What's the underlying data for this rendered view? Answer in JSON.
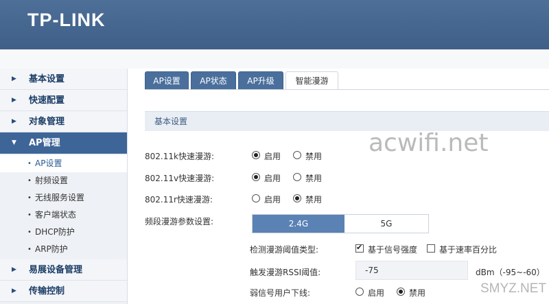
{
  "brand": {
    "logo": "TP-LINK"
  },
  "sidebar": {
    "items": [
      {
        "label": "基本设置"
      },
      {
        "label": "快速配置"
      },
      {
        "label": "对象管理"
      },
      {
        "label": "AP管理"
      },
      {
        "label": "易展设备管理"
      },
      {
        "label": "传输控制"
      }
    ],
    "sub_items": [
      {
        "label": "AP设置"
      },
      {
        "label": "射频设置"
      },
      {
        "label": "无线服务设置"
      },
      {
        "label": "客户端状态"
      },
      {
        "label": "DHCP防护"
      },
      {
        "label": "ARP防护"
      }
    ]
  },
  "tabs": [
    {
      "label": "AP设置"
    },
    {
      "label": "AP状态"
    },
    {
      "label": "AP升级"
    },
    {
      "label": "智能漫游"
    }
  ],
  "section": {
    "title": "基本设置"
  },
  "form": {
    "k_label": "802.11k快速漫游:",
    "v_label": "802.11v快速漫游:",
    "r_label": "802.11r快速漫游:",
    "enable": "启用",
    "disable": "禁用",
    "band_label": "频段漫游参数设置:",
    "band_24": "2.4G",
    "band_5": "5G",
    "threshold_label": "检测漫游阈值类型:",
    "signal_strength": "基于信号强度",
    "rate_percent": "基于速率百分比",
    "rssi_label": "触发漫游RSSI阈值:",
    "rssi_value": "-75",
    "rssi_unit": "dBm（-95~-60）",
    "weak_label": "弱信号用户下线:"
  },
  "watermarks": {
    "main": "acwifi.net",
    "corner": "SMYZ.NET"
  },
  "colors": {
    "header": "#46678f",
    "active_nav": "#3e6597",
    "tab": "#4a6f9c",
    "band_on": "#5a82b5"
  }
}
